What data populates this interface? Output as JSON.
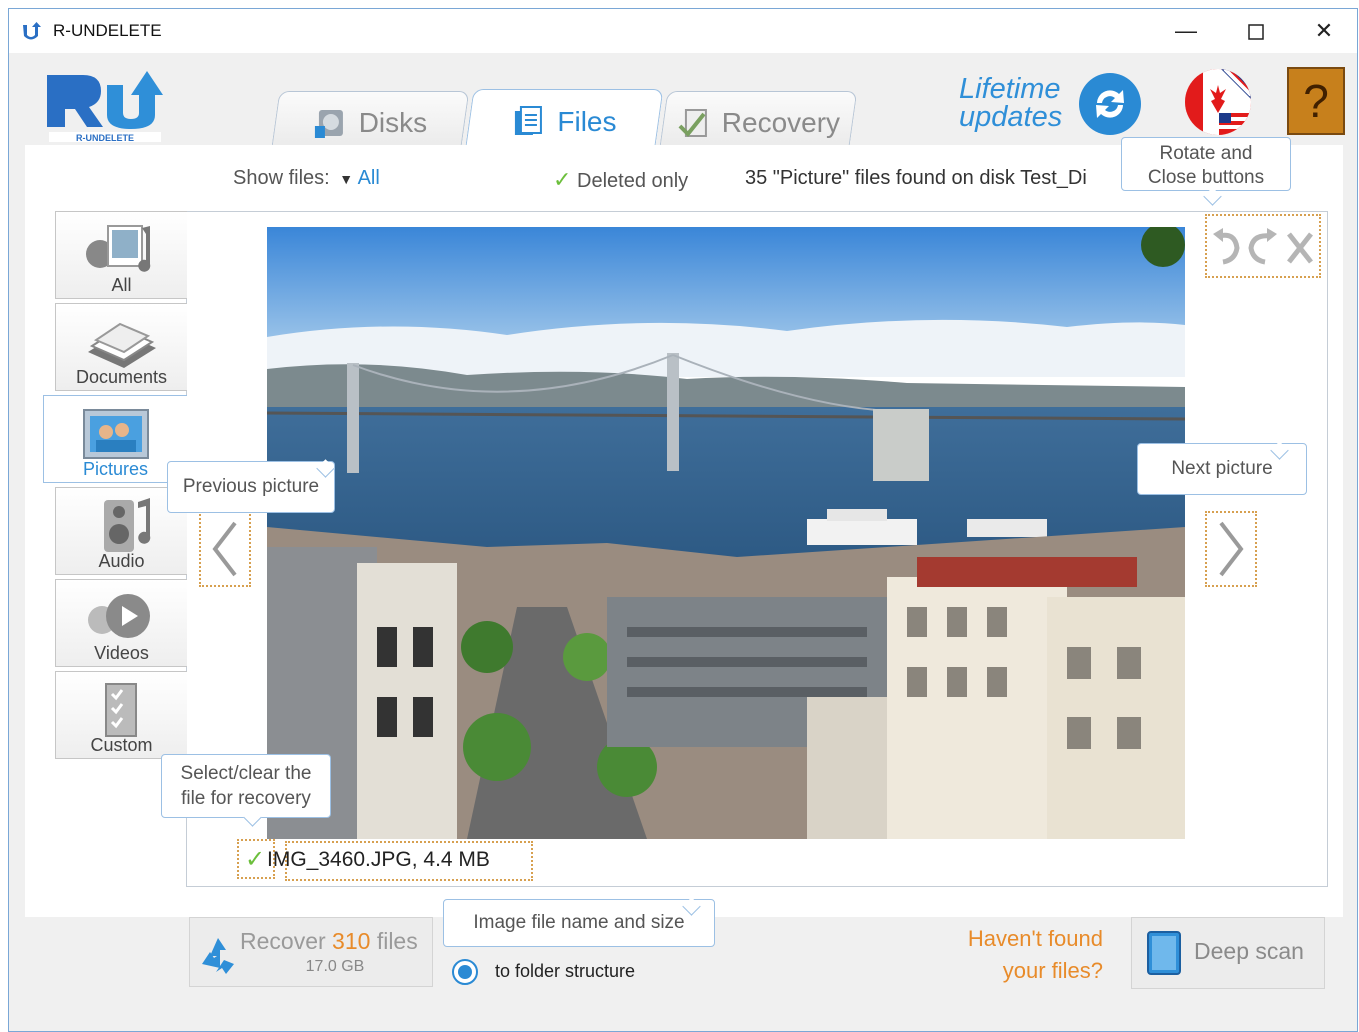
{
  "window": {
    "title": "R-UNDELETE",
    "minimize_glyph": "—",
    "maximize_glyph": "☐",
    "close_glyph": "✕"
  },
  "header": {
    "logo_text": "R-UNDELETE",
    "tabs": [
      {
        "label": "Disks",
        "icon": "disk-icon",
        "active": false
      },
      {
        "label": "Files",
        "icon": "files-icon",
        "active": true
      },
      {
        "label": "Recovery",
        "icon": "recovery-icon",
        "active": false
      }
    ],
    "lifetime_line1": "Lifetime",
    "lifetime_line2": "updates",
    "help_glyph": "?"
  },
  "filter_bar": {
    "show_files_label": "Show files:",
    "show_files_value": "All",
    "deleted_only_label": "Deleted only",
    "status_text": "35 \"Picture\" files found on disk Test_Di"
  },
  "categories": [
    {
      "label": "All",
      "icon": "all-media-icon"
    },
    {
      "label": "Documents",
      "icon": "documents-icon"
    },
    {
      "label": "Pictures",
      "icon": "pictures-icon",
      "active": true
    },
    {
      "label": "Audio",
      "icon": "audio-icon"
    },
    {
      "label": "Videos",
      "icon": "videos-icon"
    },
    {
      "label": "Custom",
      "icon": "custom-icon"
    }
  ],
  "viewer": {
    "file_name": "IMG_3460.JPG, 4.4 MB",
    "checked": true
  },
  "callouts": {
    "rotate_close": "Rotate and Close buttons",
    "rotate_close_line1": "Rotate and",
    "rotate_close_line2": "Close buttons",
    "previous": "Previous picture",
    "next": "Next picture",
    "select_line1": "Select/clear the",
    "select_line2": "file for recovery",
    "file_name_size": "Image file name and size"
  },
  "bottom": {
    "recover_prefix": "Recover",
    "recover_count": "310",
    "recover_suffix": "files",
    "recover_size": "17.0 GB",
    "folder_option": "to folder structure",
    "havent_line1": "Haven't found",
    "havent_line2": "your files?",
    "deep_scan": "Deep scan"
  },
  "colors": {
    "accent": "#2a8ad4",
    "orange": "#e88b2a",
    "callout_border": "#9cc0e4",
    "dotted": "#d7a050"
  }
}
